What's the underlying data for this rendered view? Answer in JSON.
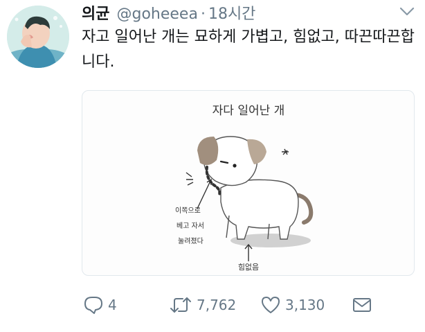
{
  "tweet": {
    "author_name": "의균",
    "handle": "@goheeea",
    "separator": "·",
    "time": "18시간",
    "text": "자고 일어난 개는 묘하게 가볍고, 힘없고, 따끈따끈합니다."
  },
  "media": {
    "title": "자다 일어난 개",
    "annotation_left": "이쪽으로\n베고 자서\n눌려졌다",
    "annotation_bottom": "힘없음"
  },
  "actions": {
    "reply_count": "4",
    "retweet_count": "7,762",
    "like_count": "3,130"
  },
  "icons": {
    "reply": "reply-icon",
    "retweet": "retweet-icon",
    "like": "heart-icon",
    "dm": "envelope-icon",
    "more": "chevron-down-icon"
  },
  "colors": {
    "text": "#14171a",
    "muted": "#657786",
    "border": "#e1e8ed"
  }
}
